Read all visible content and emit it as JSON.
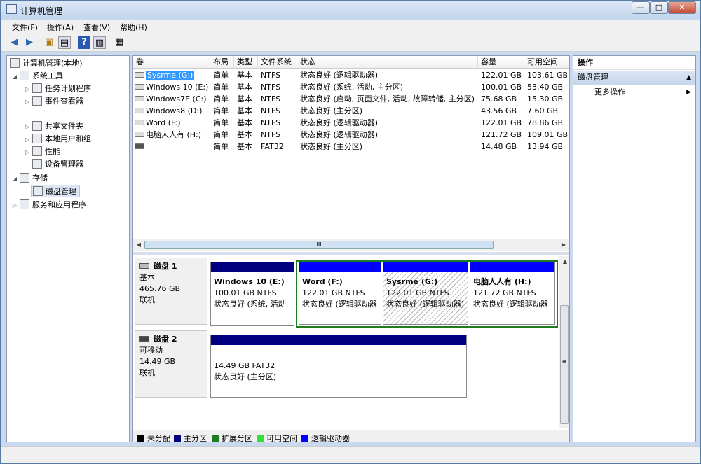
{
  "window": {
    "title": "计算机管理",
    "btn_min": "—",
    "btn_max": "□",
    "btn_close": "✕"
  },
  "menubar": {
    "items": [
      "文件(F)",
      "操作(A)",
      "查看(V)",
      "帮助(H)"
    ]
  },
  "toolbar": {
    "icons": [
      "back-icon",
      "forward-icon",
      "up-folder-icon",
      "show-hide-tree-icon",
      "help-icon",
      "properties-icon",
      "export-icon"
    ]
  },
  "tree": {
    "root": "计算机管理(本地)",
    "system_tools": "系统工具",
    "task_scheduler": "任务计划程序",
    "event_viewer": "事件查看器",
    "shared_folders": "共享文件夹",
    "local_users": "本地用户和组",
    "performance": "性能",
    "device_manager": "设备管理器",
    "storage": "存储",
    "disk_management": "磁盘管理",
    "services_apps": "服务和应用程序"
  },
  "volume_list": {
    "columns": [
      "卷",
      "布局",
      "类型",
      "文件系统",
      "状态",
      "容量",
      "可用空间"
    ],
    "rows": [
      {
        "volume": "Sysrme  (G:)",
        "layout": "简单",
        "type": "基本",
        "fs": "NTFS",
        "status": "状态良好 (逻辑驱动器)",
        "capacity": "122.01 GB",
        "free": "103.61 GB"
      },
      {
        "volume": "Windows 10 (E:)",
        "layout": "简单",
        "type": "基本",
        "fs": "NTFS",
        "status": "状态良好 (系统, 活动, 主分区)",
        "capacity": "100.01 GB",
        "free": "53.40 GB"
      },
      {
        "volume": "Windows7E (C:)",
        "layout": "简单",
        "type": "基本",
        "fs": "NTFS",
        "status": "状态良好 (启动, 页面文件, 活动, 故障转储, 主分区)",
        "capacity": "75.68 GB",
        "free": "15.30 GB"
      },
      {
        "volume": "Windows8 (D:)",
        "layout": "简单",
        "type": "基本",
        "fs": "NTFS",
        "status": "状态良好 (主分区)",
        "capacity": "43.56 GB",
        "free": "7.60 GB"
      },
      {
        "volume": "Word (F:)",
        "layout": "简单",
        "type": "基本",
        "fs": "NTFS",
        "status": "状态良好 (逻辑驱动器)",
        "capacity": "122.01 GB",
        "free": "78.86 GB"
      },
      {
        "volume": "电脑人人有 (H:)",
        "layout": "简单",
        "type": "基本",
        "fs": "NTFS",
        "status": "状态良好 (逻辑驱动器)",
        "capacity": "121.72 GB",
        "free": "109.01 GB"
      },
      {
        "volume": "",
        "layout": "简单",
        "type": "基本",
        "fs": "FAT32",
        "status": "状态良好 (主分区)",
        "capacity": "14.48 GB",
        "free": "13.94 GB"
      }
    ],
    "hscroll_thumb": "III"
  },
  "disks": [
    {
      "name": "磁盘 1",
      "kind": "基本",
      "size": "465.76 GB",
      "state": "联机",
      "partitions": [
        {
          "name": "Windows 10  (E:)",
          "size": "100.01 GB NTFS",
          "status": "状态良好 (系统, 活动,"
        },
        {
          "name": "Word  (F:)",
          "size": "122.01 GB NTFS",
          "status": "状态良好 (逻辑驱动器"
        },
        {
          "name": "Sysrme  (G:)",
          "size": "122.01 GB NTFS",
          "status": "状态良好 (逻辑驱动器)"
        },
        {
          "name": "电脑人人有  (H:)",
          "size": "121.72 GB NTFS",
          "status": "状态良好 (逻辑驱动器"
        }
      ]
    },
    {
      "name": "磁盘 2",
      "kind": "可移动",
      "size": "14.49 GB",
      "state": "联机",
      "partitions": [
        {
          "name": "",
          "size": "14.49 GB FAT32",
          "status": "状态良好 (主分区)"
        }
      ]
    }
  ],
  "legend": [
    "未分配",
    "主分区",
    "扩展分区",
    "可用空间",
    "逻辑驱动器"
  ],
  "colors": {
    "unallocated": "#000000",
    "primary": "#000080",
    "extended": "#1e7c1e",
    "free": "#33e033",
    "logical": "#0000ff",
    "selected_bg": "#3399ff"
  },
  "actions": {
    "header": "操作",
    "section": "磁盘管理",
    "more": "更多操作",
    "section_arrow": "▲",
    "more_arrow": "▶"
  }
}
